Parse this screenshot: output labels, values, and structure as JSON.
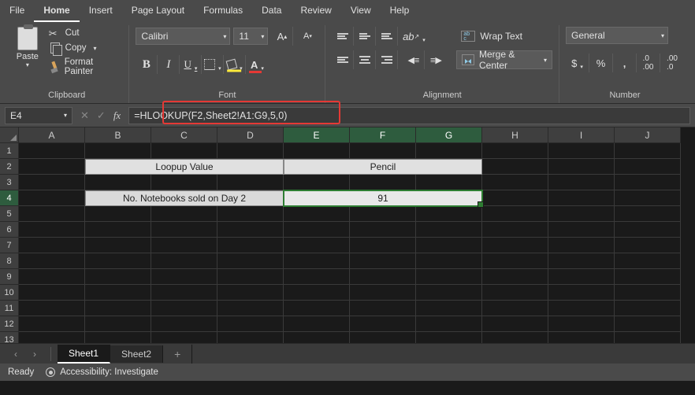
{
  "menu": {
    "items": [
      "File",
      "Home",
      "Insert",
      "Page Layout",
      "Formulas",
      "Data",
      "Review",
      "View",
      "Help"
    ],
    "active": 1
  },
  "ribbon": {
    "clipboard": {
      "paste": "Paste",
      "cut": "Cut",
      "copy": "Copy",
      "fmt": "Format Painter",
      "label": "Clipboard"
    },
    "font": {
      "name": "Calibri",
      "size": "11",
      "label": "Font"
    },
    "alignment": {
      "wrap": "Wrap Text",
      "merge": "Merge & Center",
      "label": "Alignment"
    },
    "number": {
      "format": "General",
      "label": "Number"
    }
  },
  "fbar": {
    "cellref": "E4",
    "formula": "=HLOOKUP(F2,Sheet2!A1:G9,5,0)"
  },
  "grid": {
    "cols": [
      "A",
      "B",
      "C",
      "D",
      "E",
      "F",
      "G",
      "H",
      "I",
      "J"
    ],
    "rows": [
      "1",
      "2",
      "3",
      "4",
      "5",
      "6",
      "7",
      "8",
      "9",
      "10",
      "11",
      "12",
      "13"
    ],
    "r2label": "Loopup Value",
    "r2val": "Pencil",
    "r4label": "No. Notebooks sold on Day 2",
    "r4val": "91"
  },
  "tabs": {
    "sheets": [
      "Sheet1",
      "Sheet2"
    ],
    "active": 0
  },
  "status": {
    "ready": "Ready",
    "acc": "Accessibility: Investigate"
  }
}
